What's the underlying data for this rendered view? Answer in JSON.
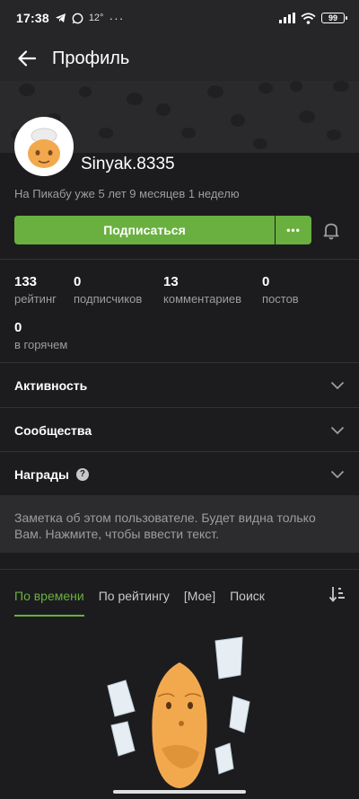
{
  "status_bar": {
    "time": "17:38",
    "temperature": "12°",
    "battery": "99"
  },
  "appbar": {
    "title": "Профиль"
  },
  "profile": {
    "username": "Sinyak.8335",
    "since": "На Пикабу уже 5 лет 9 месяцев 1 неделю",
    "subscribe_label": "Подписаться",
    "more_label": "•••"
  },
  "stats": [
    {
      "value": "133",
      "label": "рейтинг"
    },
    {
      "value": "0",
      "label": "подписчиков"
    },
    {
      "value": "13",
      "label": "комментариев"
    },
    {
      "value": "0",
      "label": "постов"
    },
    {
      "value": "0",
      "label": "в горячем"
    }
  ],
  "sections": {
    "activity": "Активность",
    "communities": "Сообщества",
    "awards": "Награды",
    "help_glyph": "?"
  },
  "note": {
    "text": "Заметка об этом пользователе. Будет видна только Вам. Нажмите, чтобы ввести текст."
  },
  "tabs": [
    {
      "label": "По времени",
      "active": true
    },
    {
      "label": "По рейтингу",
      "active": false
    },
    {
      "label": "[Мое]",
      "active": false
    },
    {
      "label": "Поиск",
      "active": false
    }
  ],
  "colors": {
    "accent": "#6ab040",
    "background": "#1c1c1e",
    "bar": "#262628"
  },
  "icons": [
    "back-arrow-icon",
    "telegram-icon",
    "whatsapp-icon",
    "signal-icon",
    "wifi-icon",
    "battery-icon",
    "bell-icon",
    "chevron-down-icon",
    "help-icon",
    "sort-icon"
  ]
}
